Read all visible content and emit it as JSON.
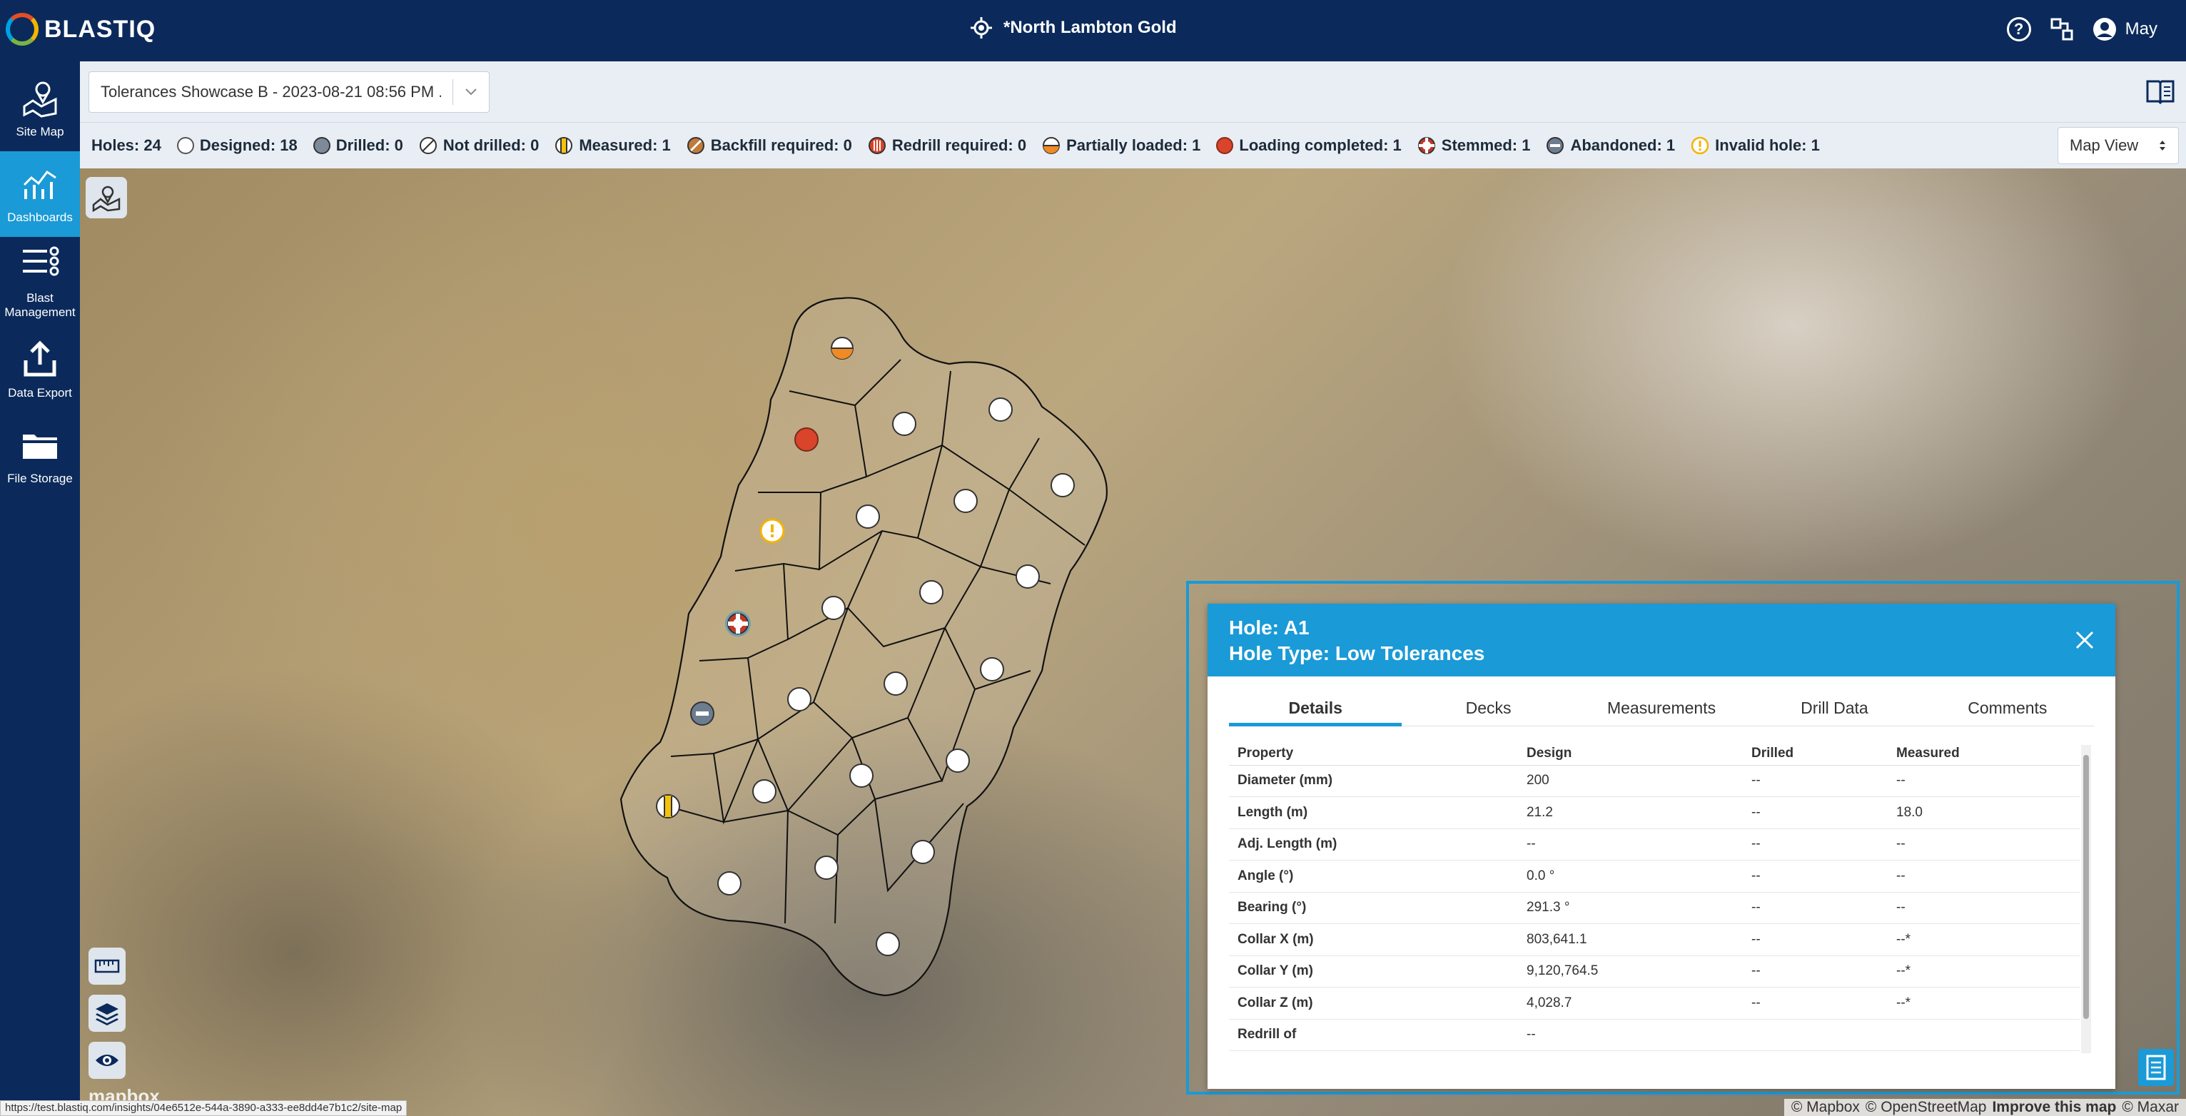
{
  "app": {
    "logo_text": "BLASTIQ",
    "site_name": "*North Lambton Gold",
    "user_name": "May"
  },
  "nav": [
    {
      "label": "Site Map",
      "icon": "map-icon"
    },
    {
      "label": "Dashboards",
      "icon": "dashboard-icon",
      "active": true
    },
    {
      "label": "Blast Management",
      "icon": "blast-management-icon"
    },
    {
      "label": "Data Export",
      "icon": "export-icon"
    },
    {
      "label": "File Storage",
      "icon": "folder-icon"
    }
  ],
  "plan": {
    "selected": "Tolerances Showcase B - 2023-08-21 08:56 PM ..."
  },
  "status": {
    "holes": "Holes: 24",
    "designed": "Designed: 18",
    "drilled": "Drilled: 0",
    "not_drilled": "Not drilled: 0",
    "measured": "Measured: 1",
    "backfill": "Backfill required: 0",
    "redrill": "Redrill required: 0",
    "partially_loaded": "Partially loaded: 1",
    "loading_completed": "Loading completed: 1",
    "stemmed": "Stemmed: 1",
    "abandoned": "Abandoned: 1",
    "invalid": "Invalid hole: 1"
  },
  "view_select": {
    "value": "Map View"
  },
  "hole_panel": {
    "title": "Hole: A1",
    "type": "Hole Type: Low Tolerances",
    "tabs": [
      "Details",
      "Decks",
      "Measurements",
      "Drill Data",
      "Comments"
    ],
    "columns": [
      "Property",
      "Design",
      "Drilled",
      "Measured"
    ],
    "rows": [
      [
        "Diameter (mm)",
        "200",
        "--",
        "--"
      ],
      [
        "Length (m)",
        "21.2",
        "--",
        "18.0"
      ],
      [
        "Adj. Length (m)",
        "--",
        "--",
        "--"
      ],
      [
        "Angle (°)",
        "0.0 °",
        "--",
        "--"
      ],
      [
        "Bearing (°)",
        "291.3 °",
        "--",
        "--"
      ],
      [
        "Collar X (m)",
        "803,641.1",
        "--",
        "--*"
      ],
      [
        "Collar Y (m)",
        "9,120,764.5",
        "--",
        "--*"
      ],
      [
        "Collar Z (m)",
        "4,028.7",
        "--",
        "--*"
      ],
      [
        "Redrill of",
        "--",
        "",
        ""
      ]
    ]
  },
  "attribution": {
    "mapbox": "© Mapbox",
    "osm": "© OpenStreetMap",
    "improve": "Improve this map",
    "maxar": "© Maxar"
  },
  "status_url": "https://test.blastiq.com/insights/04e6512e-544a-3890-a333-ee8dd4e7b1c2/site-map",
  "mapbox_logo": "mapbox",
  "colors": {
    "navy": "#0b2a5b",
    "accent": "#1a9ad6",
    "loading": "#d9442b",
    "invalid": "#f4b400"
  }
}
